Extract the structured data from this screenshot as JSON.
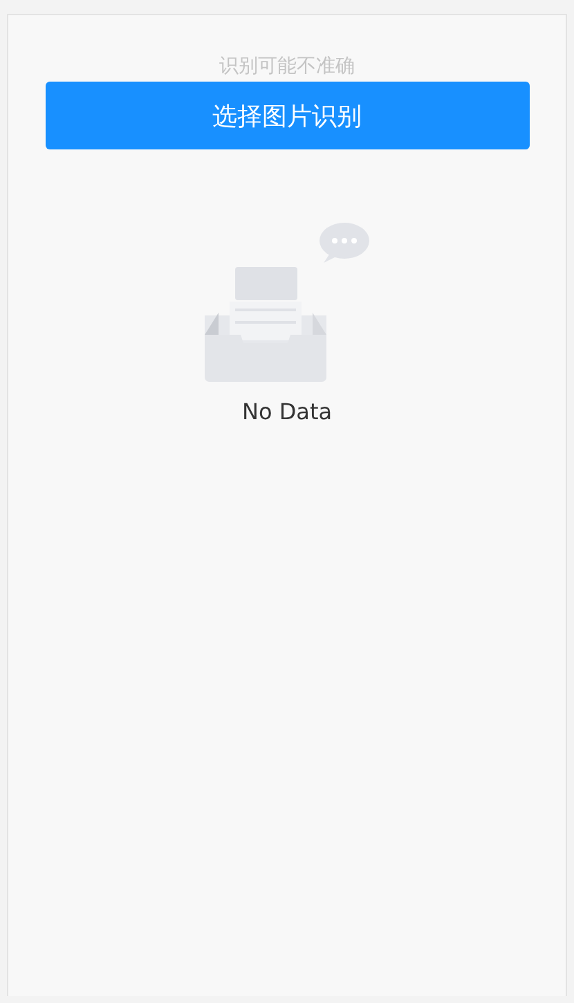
{
  "hint": "识别可能不准确",
  "button": {
    "label": "选择图片识别"
  },
  "empty": {
    "text": "No Data"
  }
}
